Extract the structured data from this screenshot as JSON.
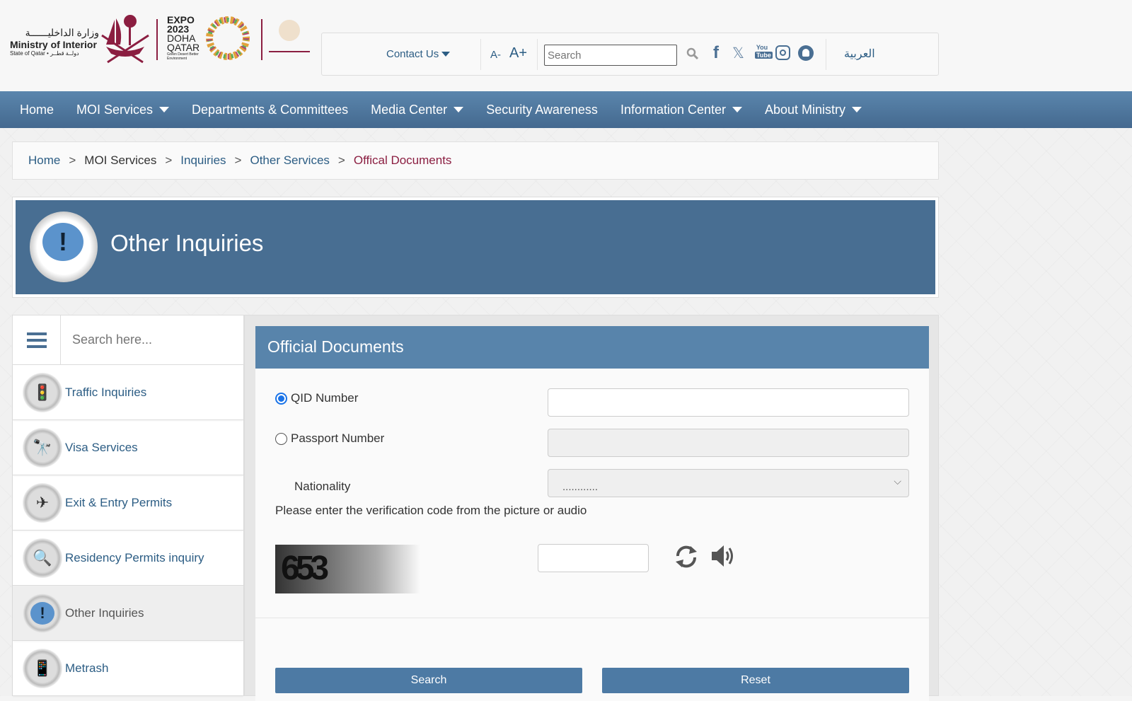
{
  "header": {
    "moi_arabic": "وزارة الداخليــــــة",
    "moi_english": "Ministry of Interior",
    "moi_state": "State of Qatar • دولــة قطــر",
    "expo_lines": [
      "EXPO",
      "2023",
      "DOHA",
      "QATAR"
    ],
    "expo_tagline": "Green Desert Better Environment",
    "family_logo": "الأسرة ثروة وطن"
  },
  "topbar": {
    "contact_us": "Contact Us",
    "font_decrease": "A-",
    "font_increase": "A+",
    "search_placeholder": "Search",
    "language": "العربية",
    "social_icons": [
      "facebook-icon",
      "x-icon",
      "youtube-icon",
      "instagram-icon",
      "snapchat-icon"
    ]
  },
  "nav": {
    "items": [
      {
        "label": "Home",
        "dropdown": false
      },
      {
        "label": "MOI Services",
        "dropdown": true
      },
      {
        "label": "Departments & Committees",
        "dropdown": false
      },
      {
        "label": "Media Center",
        "dropdown": true
      },
      {
        "label": "Security Awareness",
        "dropdown": false
      },
      {
        "label": "Information Center",
        "dropdown": true
      },
      {
        "label": "About Ministry",
        "dropdown": true
      }
    ]
  },
  "breadcrumb": {
    "items": [
      "Home",
      "MOI Services",
      "Inquiries",
      "Other Services"
    ],
    "current": "Offical Documents",
    "separator": ">"
  },
  "banner": {
    "title": "Other Inquiries"
  },
  "sidebar": {
    "search_placeholder": "Search here...",
    "items": [
      {
        "label": "Traffic Inquiries",
        "icon": "traffic-light-icon"
      },
      {
        "label": "Visa Services",
        "icon": "binoculars-icon"
      },
      {
        "label": "Exit & Entry Permits",
        "icon": "airplane-icon"
      },
      {
        "label": "Residency Permits inquiry",
        "icon": "document-search-icon"
      },
      {
        "label": "Other Inquiries",
        "icon": "exclamation-bubble-icon",
        "active": true
      },
      {
        "label": "Metrash",
        "icon": "metrash-icon"
      }
    ]
  },
  "form": {
    "title": "Official Documents",
    "qid_label": "QID Number",
    "qid_selected": true,
    "passport_label": "Passport Number",
    "nationality_label": "Nationality",
    "nationality_value": "............",
    "captcha_instruction": "Please enter the verification code from the picture or audio",
    "captcha_code": "653",
    "search_button": "Search",
    "reset_button": "Reset"
  },
  "colors": {
    "primary": "#486e92",
    "panel_header": "#5884ab",
    "accent": "#8b1e41",
    "link": "#2c5d84"
  }
}
